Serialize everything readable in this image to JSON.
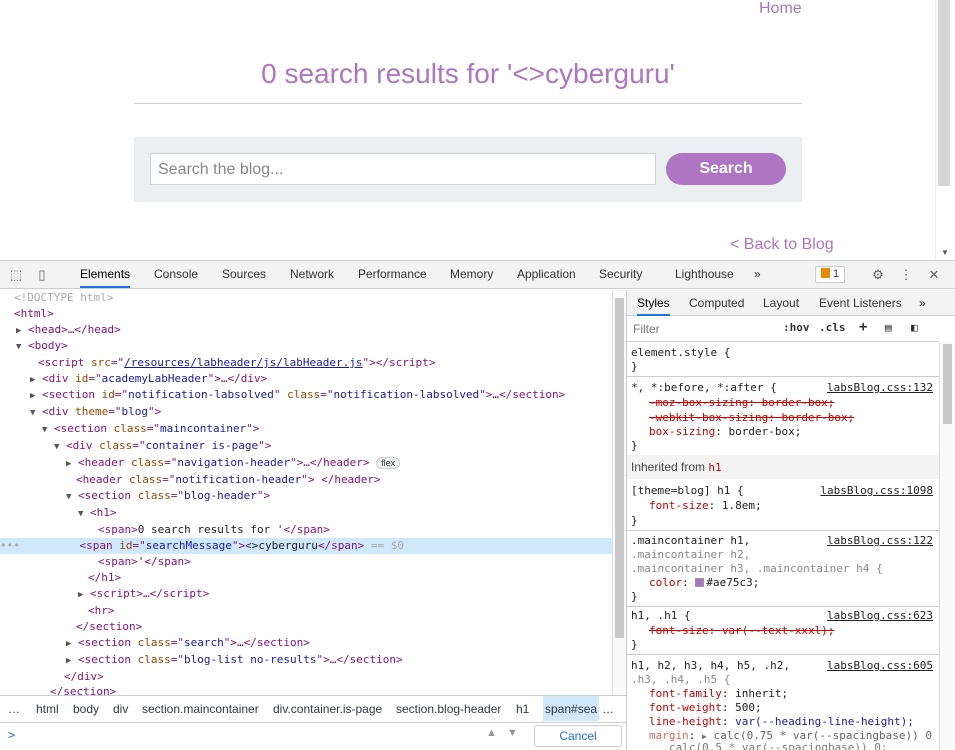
{
  "page": {
    "home": "Home",
    "title": "0 search results for '<>cyberguru'",
    "search_placeholder": "Search the blog...",
    "search_button": "Search",
    "back": "< Back to Blog"
  },
  "devtools": {
    "tabs": [
      "Elements",
      "Console",
      "Sources",
      "Network",
      "Performance",
      "Memory",
      "Application",
      "Security",
      "Lighthouse"
    ],
    "more": "»",
    "issues_count": "1",
    "dom": {
      "doctype": "<!DOCTYPE html>",
      "l_html": "<html>",
      "l_head": "<head>…</head>",
      "l_body": "<body>",
      "script_src": "/resources/labheader/js/labHeader.js",
      "academy_id": "academyLabHeader",
      "notif_id": "notification-labsolved",
      "notif_class": "notification-labsolved",
      "theme": "blog",
      "sec_class": "maincontainer",
      "cont_class": "container is-page",
      "nav_class": "navigation-header",
      "flex": "flex",
      "notif_head_class": "notification-header",
      "bh_class": "blog-header",
      "span1": "0 search results for '",
      "span_id": "searchMessage",
      "span_text": "<>cyberguru",
      "dollar": "== $0",
      "span3": "'",
      "search_class": "search",
      "bl_class": "blog-list no-results"
    },
    "crumbs": [
      "…",
      "html",
      "body",
      "div",
      "section.maincontainer",
      "div.container.is-page",
      "section.blog-header",
      "h1",
      "span#sea",
      "…"
    ],
    "console_prompt": ">",
    "cancel": "Cancel",
    "styles": {
      "tabs": [
        "Styles",
        "Computed",
        "Layout",
        "Event Listeners"
      ],
      "more": "»",
      "filter": "Filter",
      "hov": ":hov",
      "cls": ".cls",
      "element_style": "element.style {",
      "close": "}",
      "r1_sel": "*, *:before, *:after {",
      "r1_src": "labsBlog.css:132",
      "r1_p1": "-moz-box-sizing: border-box;",
      "r1_p2": "-webkit-box-sizing: border-box;",
      "r1_p3n": "box-sizing",
      "r1_p3v": "border-box;",
      "inherited": "Inherited from ",
      "inherited_el": "h1",
      "r2_sel": "[theme=blog] h1 {",
      "r2_src": "labsBlog.css:1098",
      "r2_pn": "font-size",
      "r2_pv": "1.8em;",
      "r3_sel1": ".maincontainer h1,",
      "r3_sel2": ".maincontainer h2,",
      "r3_sel3": ".maincontainer h3, .maincontainer h4 {",
      "r3_src": "labsBlog.css:122",
      "r3_pn": "color",
      "r3_pv": "#ae75c3;",
      "r4_sel": "h1, .h1 {",
      "r4_src": "labsBlog.css:623",
      "r4_p": "font-size: var(--text-xxxl);",
      "r5_sel1": "h1, h2, h3, h4, h5, .h2,",
      "r5_sel2": ".h3, .h4, .h5 {",
      "r5_src": "labsBlog.css:605",
      "r5_p1n": "font-family",
      "r5_p1v": "inherit;",
      "r5_p2n": "font-weight",
      "r5_p2v": "500;",
      "r5_p3n": "line-height",
      "r5_p3v": "var(--heading-line-height);",
      "r5_p4n": "margin",
      "r5_p4v": "calc(0.75 * var(--spacingbase)) 0",
      "r5_p4v2": "calc(0.5 * var(--spacingbase)) 0;"
    },
    "accent": "#1a73e8"
  }
}
